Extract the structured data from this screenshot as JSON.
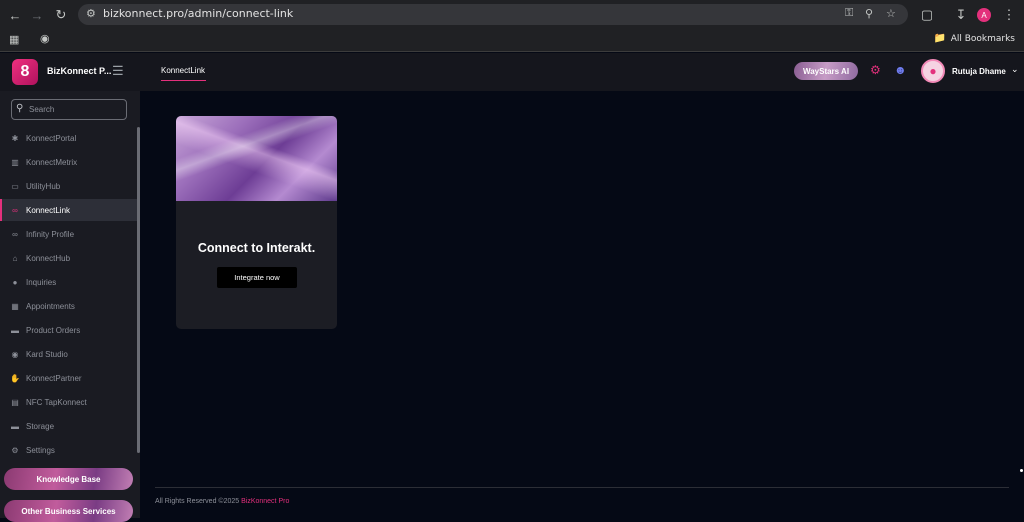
{
  "browser": {
    "url": "bizkonnect.pro/admin/connect-link",
    "profile_initial": "A",
    "bookmarks_label": "All Bookmarks"
  },
  "brand": {
    "name": "BizKonnect P...",
    "logo_glyph": "8"
  },
  "search": {
    "placeholder": "Search"
  },
  "sidebar": {
    "items": [
      {
        "label": "KonnectPortal",
        "icon": "asterisk-icon"
      },
      {
        "label": "KonnectMetrix",
        "icon": "chart-icon"
      },
      {
        "label": "UtilityHub",
        "icon": "toolbox-icon"
      },
      {
        "label": "KonnectLink",
        "icon": "link-icon"
      },
      {
        "label": "Infinity Profile",
        "icon": "infinity-icon"
      },
      {
        "label": "KonnectHub",
        "icon": "hub-icon"
      },
      {
        "label": "Inquiries",
        "icon": "info-icon"
      },
      {
        "label": "Appointments",
        "icon": "calendar-icon"
      },
      {
        "label": "Product Orders",
        "icon": "cart-icon"
      },
      {
        "label": "Kard Studio",
        "icon": "eye-icon"
      },
      {
        "label": "KonnectPartner",
        "icon": "handshake-icon"
      },
      {
        "label": "NFC TapKonnect",
        "icon": "nfc-icon"
      },
      {
        "label": "Storage",
        "icon": "storage-icon"
      },
      {
        "label": "Settings",
        "icon": "settings-icon"
      }
    ],
    "active_index": 3,
    "knowledge_base": "Knowledge Base",
    "other_services": "Other Business Services"
  },
  "topbar": {
    "active_tab": "KonnectLink",
    "waystars": "WayStars AI",
    "user_name": "Rutuja Dhame"
  },
  "card": {
    "title": "Connect to Interakt.",
    "button": "Integrate now"
  },
  "footer": {
    "text": "All Rights Reserved ©2025 ",
    "brand": "BizKonnect Pro"
  },
  "colors": {
    "accent": "#e3307c",
    "bg": "#050915",
    "sidebar": "#1a1b22"
  }
}
